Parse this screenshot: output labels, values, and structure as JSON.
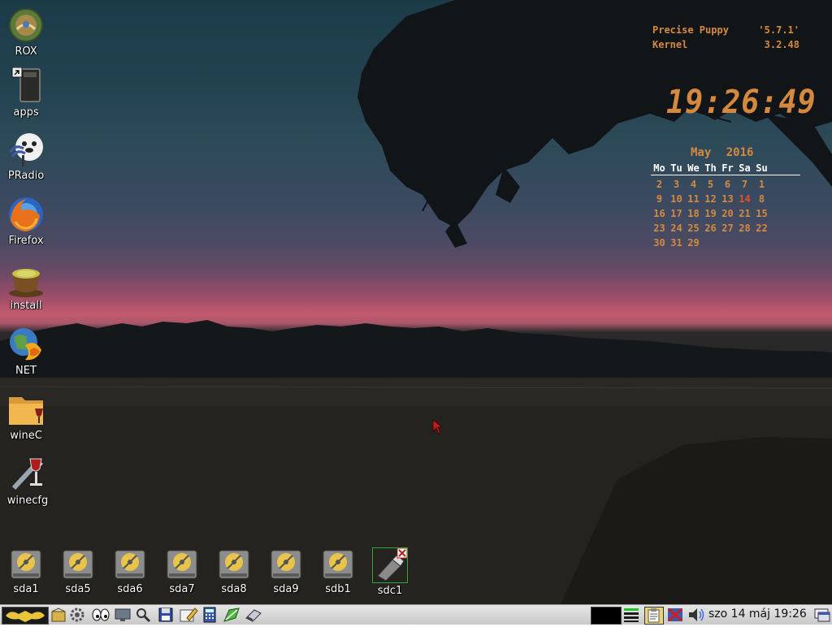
{
  "desktop_icons": [
    {
      "label": "ROX",
      "icon": "rox-globe-icon"
    },
    {
      "label": "apps",
      "icon": "apps-folder-icon"
    },
    {
      "label": "PRadio",
      "icon": "pradio-icon"
    },
    {
      "label": "Firefox",
      "icon": "firefox-icon"
    },
    {
      "label": "install",
      "icon": "install-teacup-icon"
    },
    {
      "label": "NET",
      "icon": "net-globe-icon"
    },
    {
      "label": "wineC",
      "icon": "wine-folder-icon"
    },
    {
      "label": "winecfg",
      "icon": "winecfg-icon"
    }
  ],
  "drives": [
    {
      "label": "sda1",
      "icon": "hard-drive-icon"
    },
    {
      "label": "sda5",
      "icon": "hard-drive-icon"
    },
    {
      "label": "sda6",
      "icon": "hard-drive-icon"
    },
    {
      "label": "sda7",
      "icon": "hard-drive-icon"
    },
    {
      "label": "sda8",
      "icon": "hard-drive-icon"
    },
    {
      "label": "sda9",
      "icon": "hard-drive-icon"
    },
    {
      "label": "sdb1",
      "icon": "hard-drive-icon"
    },
    {
      "label": "sdc1",
      "icon": "usb-drive-icon"
    }
  ],
  "conky": {
    "os_key": "Precise Puppy",
    "os_value": "'5.7.1'",
    "kernel_key": "Kernel",
    "kernel_value": "3.2.48",
    "time": "19:26:49",
    "month": "May",
    "year": "2016",
    "weekdays": [
      "Mo",
      "Tu",
      "We",
      "Th",
      "Fr",
      "Sa",
      "Su"
    ],
    "weeks": [
      [
        "2",
        "3",
        "4",
        "5",
        "6",
        "7",
        "1"
      ],
      [
        "9",
        "10",
        "11",
        "12",
        "13",
        "14",
        "8"
      ],
      [
        "16",
        "17",
        "18",
        "19",
        "20",
        "21",
        "15"
      ],
      [
        "23",
        "24",
        "25",
        "26",
        "27",
        "28",
        "22"
      ],
      [
        "30",
        "31",
        "29",
        "",
        "",
        "",
        ""
      ]
    ],
    "today": "14"
  },
  "taskbar": {
    "launchers": [
      "menu-logo-icon",
      "package-icon",
      "settings-gear-icon",
      "eyes-icon",
      "monitor-icon",
      "search-icon",
      "save-floppy-icon",
      "edit-icon",
      "calculator-icon",
      "draw-icon",
      "eraser-icon"
    ],
    "tray": [
      "pager-widget",
      "network-status-icon",
      "clipboard-icon",
      "firewall-icon",
      "volume-icon"
    ],
    "clock": "szo 14 máj 19:26",
    "show_desktop": "show-desktop-icon"
  },
  "colors": {
    "conky_accent": "#d4893f",
    "conky_today": "#e2502a",
    "label_text": "#ffffff",
    "taskbar_bg": "#d8d8d8"
  }
}
